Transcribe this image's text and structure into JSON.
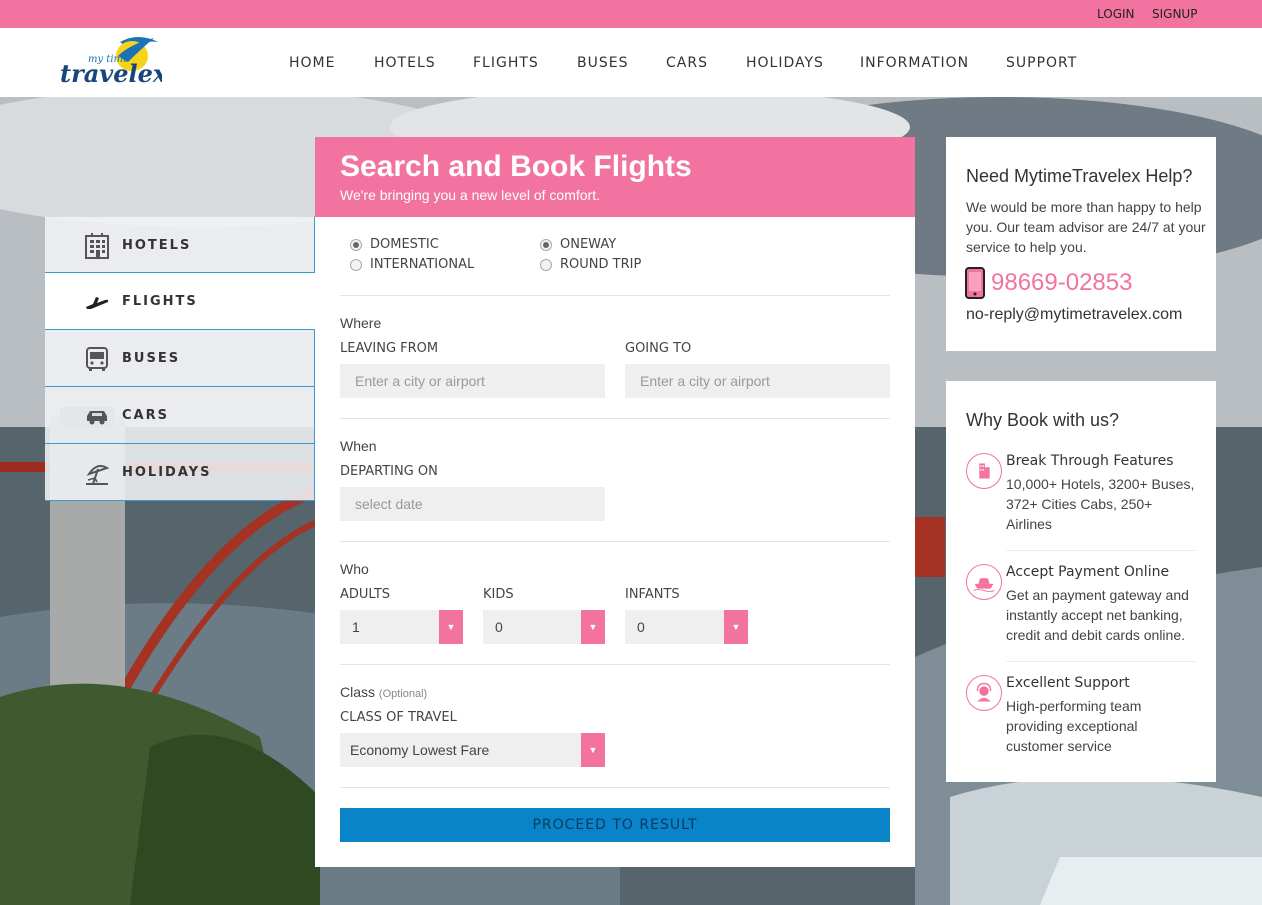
{
  "colors": {
    "brand_pink": "#f2739f",
    "button_blue": "#0a84c8",
    "tab_border": "#3b9bd1"
  },
  "topbar": {
    "login": "LOGIN",
    "signup": "SIGNUP"
  },
  "logo": {
    "line1": "my time",
    "line2": "travelex"
  },
  "nav": [
    "HOME",
    "HOTELS",
    "FLIGHTS",
    "BUSES",
    "CARS",
    "HOLIDAYS",
    "INFORMATION",
    "SUPPORT"
  ],
  "tabs": [
    {
      "label": "HOTELS",
      "icon": "hotel-icon"
    },
    {
      "label": "FLIGHTS",
      "icon": "plane-icon",
      "active": true
    },
    {
      "label": "BUSES",
      "icon": "bus-icon"
    },
    {
      "label": "CARS",
      "icon": "car-icon"
    },
    {
      "label": "HOLIDAYS",
      "icon": "beach-icon"
    }
  ],
  "form": {
    "title": "Search and Book Flights",
    "subtitle": "We're bringing you a new level of comfort.",
    "radios": {
      "domestic": "DOMESTIC",
      "international": "INTERNATIONAL",
      "oneway": "ONEWAY",
      "roundtrip": "ROUND TRIP",
      "selected_region": "DOMESTIC",
      "selected_trip": "ONEWAY"
    },
    "where": {
      "heading": "Where",
      "leaving_label": "LEAVING FROM",
      "leaving_placeholder": "Enter a city or airport",
      "going_label": "GOING TO",
      "going_placeholder": "Enter a city or airport"
    },
    "when": {
      "heading": "When",
      "departing_label": "DEPARTING ON",
      "date_placeholder": "select date"
    },
    "who": {
      "heading": "Who",
      "adults_label": "ADULTS",
      "adults_value": "1",
      "kids_label": "KIDS",
      "kids_value": "0",
      "infants_label": "INFANTS",
      "infants_value": "0"
    },
    "class": {
      "heading": "Class",
      "optional": "(Optional)",
      "label": "CLASS OF TRAVEL",
      "value": "Economy Lowest Fare"
    },
    "submit": "PROCEED TO RESULT"
  },
  "help": {
    "title": "Need MytimeTravelex Help?",
    "text": "We would be more than happy to help you. Our team advisor are 24/7 at your service to help you.",
    "phone": "98669-02853",
    "email": "no-reply@mytimetravelex.com"
  },
  "why": {
    "title": "Why Book with us?",
    "items": [
      {
        "title": "Break Through Features",
        "desc": "10,000+ Hotels, 3200+ Buses, 372+ Cities Cabs, 250+ Airlines",
        "icon": "building-icon"
      },
      {
        "title": "Accept Payment Online",
        "desc": "Get an payment gateway and instantly accept net banking, credit and debit cards online.",
        "icon": "ship-icon"
      },
      {
        "title": "Excellent Support",
        "desc": "High-performing team providing exceptional customer service",
        "icon": "support-agent-icon"
      }
    ]
  }
}
